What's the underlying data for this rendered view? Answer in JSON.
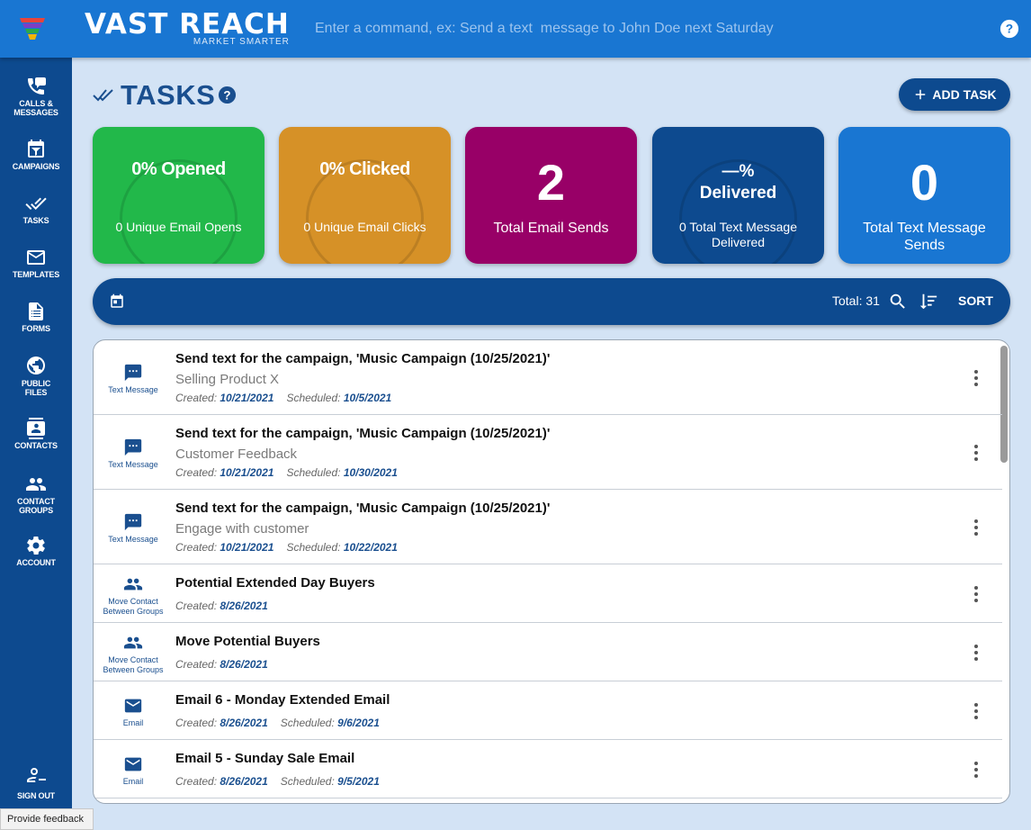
{
  "app": {
    "brand": "VAST REACH",
    "tagline": "MARKET SMARTER",
    "command_placeholder": "Enter a command, ex: Send a text  message to John Doe next Saturday"
  },
  "nav": {
    "calls": "CALLS & MESSAGES",
    "campaigns": "CAMPAIGNS",
    "tasks": "TASKS",
    "templates": "TEMPLATES",
    "forms": "FORMS",
    "files": "PUBLIC FILES",
    "contacts": "CONTACTS",
    "groups": "CONTACT GROUPS",
    "account": "ACCOUNT",
    "signout": "SIGN OUT"
  },
  "feedback": "Provide feedback",
  "header": {
    "title": "TASKS",
    "add_label": "ADD TASK"
  },
  "stats": {
    "opened": {
      "value": "0% Opened",
      "sub": "0 Unique Email Opens",
      "color": "#22b84a"
    },
    "clicked": {
      "value": "0% Clicked",
      "sub": "0 Unique Email Clicks",
      "color": "#d69127"
    },
    "sends": {
      "value": "2",
      "sub": "Total Email Sends",
      "color": "#980067"
    },
    "delivered": {
      "value_line1": "—%",
      "value_line2": "Delivered",
      "sub": "0 Total Text Message Delivered",
      "color": "#0d4a8f"
    },
    "text_sends": {
      "value": "0",
      "sub": "Total Text Message Sends",
      "color": "#1976d2"
    }
  },
  "toolbar": {
    "total": "Total: 31",
    "sort": "SORT"
  },
  "labels": {
    "created": "Created:",
    "scheduled": "Scheduled:"
  },
  "tasks": [
    {
      "type": "Text Message",
      "title": "Send text for the campaign, 'Music Campaign (10/25/2021)'",
      "subtitle": "Selling Product X",
      "created": "10/21/2021",
      "scheduled": "10/5/2021"
    },
    {
      "type": "Text Message",
      "title": "Send text for the campaign, 'Music Campaign (10/25/2021)'",
      "subtitle": "Customer Feedback",
      "created": "10/21/2021",
      "scheduled": "10/30/2021"
    },
    {
      "type": "Text Message",
      "title": "Send text for the campaign, 'Music Campaign (10/25/2021)'",
      "subtitle": "Engage with customer",
      "created": "10/21/2021",
      "scheduled": "10/22/2021"
    },
    {
      "type_line1": "Move Contact",
      "type_line2": "Between Groups",
      "title": "Potential Extended Day Buyers",
      "created": "8/26/2021"
    },
    {
      "type_line1": "Move Contact",
      "type_line2": "Between Groups",
      "title": "Move Potential Buyers",
      "created": "8/26/2021"
    },
    {
      "type": "Email",
      "title": "Email 6 - Monday Extended Email",
      "created": "8/26/2021",
      "scheduled": "9/6/2021"
    },
    {
      "type": "Email",
      "title": "Email 5 - Sunday Sale Email",
      "created": "8/26/2021",
      "scheduled": "9/5/2021"
    }
  ]
}
